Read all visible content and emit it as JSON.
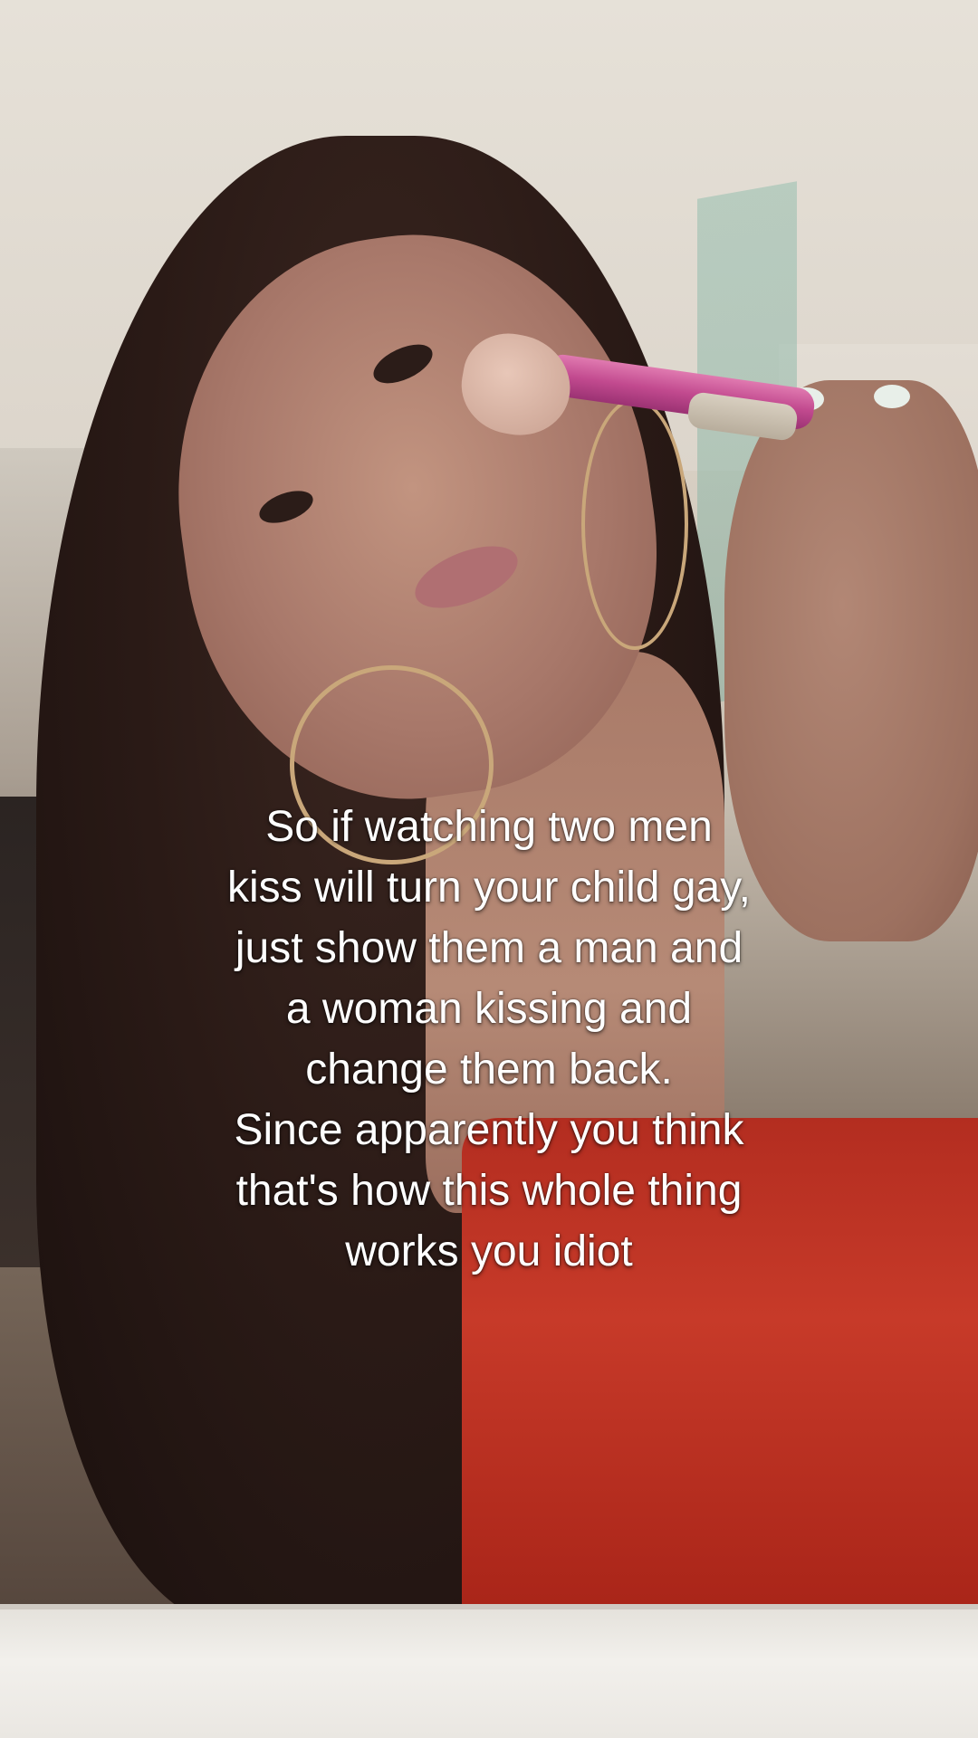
{
  "video": {
    "caption_lines": [
      "So if watching two men",
      "kiss will turn your child gay,",
      "just show them a man and",
      "a woman kissing and",
      "change them back.",
      "Since apparently you think",
      "that's how this whole thing",
      "works you idiot"
    ]
  },
  "colors": {
    "caption_text": "#ffffff",
    "top_red": "#c73a29",
    "brush_pink": "#c24a8f"
  }
}
